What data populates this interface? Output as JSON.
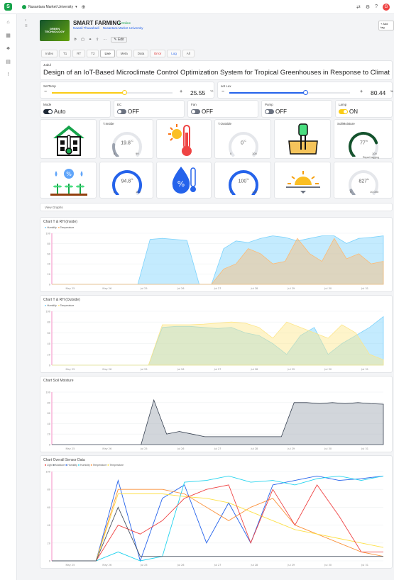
{
  "topbar": {
    "workspace": "Nusantara Market University",
    "icons": [
      "share-icon",
      "settings-icon",
      "help-icon"
    ],
    "avatar": "G"
  },
  "header": {
    "title": "SMART FARMING",
    "status": "Online",
    "meta1": "Nawali Thuwahadi",
    "meta2": "Nusantara Market University",
    "logo_text": "GREEN TECHNOLOGY",
    "action": "Edit",
    "add_button": "Add tag"
  },
  "tabs": [
    "Index",
    "T1",
    "RT",
    "T2",
    "Live",
    "Meta",
    "Data",
    "Error",
    "Log",
    "All"
  ],
  "title_card": {
    "label": "Judul",
    "text": "Design of an IoT-Based Microclimate Control Optimization System for Tropical Greenhouses in Response to Climat"
  },
  "sliders": [
    {
      "label": "SetTemp",
      "value": "25.55",
      "unit": "°C",
      "fraction": 0.6
    },
    {
      "label": "set Lux",
      "value": "80.44",
      "unit": "%",
      "fraction": 0.63
    }
  ],
  "toggles": [
    {
      "label": "Mode",
      "state": "Auto",
      "on": true,
      "color": "#1f2937"
    },
    {
      "label": "EC",
      "state": "OFF",
      "on": false,
      "color": "#6b7280"
    },
    {
      "label": "Fan",
      "state": "OFF",
      "on": false,
      "color": "#6b7280"
    },
    {
      "label": "Pump",
      "state": "OFF",
      "on": false,
      "color": "#6b7280"
    },
    {
      "label": "Lamp",
      "state": "ON",
      "on": true,
      "color": "#facc15"
    }
  ],
  "gauges_row1": [
    {
      "label": "T.Inside",
      "value": "19.8",
      "unit": "°C",
      "min": "0",
      "max": "99",
      "fraction": 0.2,
      "color": "#9ca3af"
    },
    {
      "label": "T.Outside",
      "value": "0",
      "unit": "°C",
      "min": "0",
      "max": "100",
      "fraction": 0.0,
      "color": "#9ca3af"
    },
    {
      "label": "SoilMoisture",
      "value": "77",
      "unit": "%",
      "min": "0",
      "max": "100",
      "fraction": 0.77,
      "color": "#14532d"
    }
  ],
  "gauges_row2": [
    {
      "label": "",
      "value": "94.8",
      "unit": "%",
      "min": "0",
      "max": "100",
      "fraction": 0.948,
      "color": "#2563eb"
    },
    {
      "label": "",
      "value": "100",
      "unit": "%",
      "min": "0",
      "max": "100",
      "fraction": 1.0,
      "color": "#2563eb"
    },
    {
      "label": "",
      "value": "827",
      "unit": "lx",
      "min": "0",
      "max": "10,000",
      "fraction": 0.083,
      "color": "#9ca3af"
    }
  ],
  "tooltip": "Report lagging",
  "graph_section": "View Graphs",
  "colors": {
    "humidity": "#7dd3fc",
    "temperature": "#fdba74",
    "soil": "#9ca3af"
  },
  "chart_data": [
    {
      "type": "area",
      "title": "Chart T & RH (Inside)",
      "series": [
        {
          "name": "Humidity",
          "values": [
            0,
            0,
            0,
            0,
            0,
            0,
            0,
            0,
            88,
            90,
            88,
            86,
            0,
            0,
            70,
            85,
            82,
            90,
            95,
            92,
            85,
            90,
            95,
            95,
            80,
            90,
            92,
            95
          ]
        },
        {
          "name": "Temperature",
          "values": [
            0,
            0,
            0,
            0,
            0,
            0,
            0,
            0,
            0,
            0,
            0,
            0,
            0,
            0,
            30,
            40,
            70,
            60,
            40,
            45,
            90,
            60,
            45,
            90,
            50,
            60,
            40,
            45
          ]
        }
      ],
      "x": [
        "May 25",
        "May 26",
        "Jul 25",
        "Jul 26",
        "Jul 27",
        "Jul 28",
        "Jul 29",
        "Jul 30",
        "Jul 31"
      ],
      "ylim": [
        0,
        100
      ]
    },
    {
      "type": "area",
      "title": "Chart T & RH (Outside)",
      "series": [
        {
          "name": "Humidity",
          "values": [
            0,
            0,
            0,
            0,
            0,
            0,
            0,
            0,
            70,
            72,
            72,
            70,
            68,
            70,
            60,
            55,
            40,
            20,
            55,
            70,
            20,
            40,
            55,
            70,
            90
          ]
        },
        {
          "name": "Temperature",
          "values": [
            0,
            0,
            0,
            0,
            0,
            0,
            0,
            0,
            75,
            75,
            75,
            76,
            78,
            80,
            78,
            70,
            50,
            80,
            70,
            60,
            50,
            75,
            60,
            20,
            10
          ]
        }
      ],
      "x": [
        "May 25",
        "May 26",
        "Jul 25",
        "Jul 26",
        "Jul 27",
        "Jul 28",
        "Jul 29",
        "Jul 30",
        "Jul 31"
      ],
      "ylim": [
        0,
        100
      ]
    },
    {
      "type": "area",
      "title": "Chart Soil Moisture",
      "series": [
        {
          "name": "Soil",
          "values": [
            0,
            0,
            0,
            0,
            0,
            0,
            0,
            0,
            85,
            20,
            25,
            20,
            15,
            15,
            15,
            15,
            15,
            15,
            15,
            80,
            80,
            78,
            80,
            78,
            80,
            78,
            77
          ]
        }
      ],
      "x": [
        "May 25",
        "May 26",
        "Jul 25",
        "Jul 26",
        "Jul 27",
        "Jul 28",
        "Jul 29",
        "Jul 30",
        "Jul 31"
      ],
      "ylim": [
        0,
        100
      ]
    },
    {
      "type": "line",
      "title": "Chart Overall Sensor Data",
      "legend": [
        "Light",
        "Moisture",
        "Humidity",
        "Humidity",
        "Temperature",
        "Temperature"
      ],
      "x": [
        "May 25",
        "May 26",
        "Jul 25",
        "Jul 26",
        "Jul 27",
        "Jul 28",
        "Jul 29",
        "Jul 30",
        "Jul 31"
      ],
      "ylim": [
        0,
        100
      ]
    }
  ]
}
